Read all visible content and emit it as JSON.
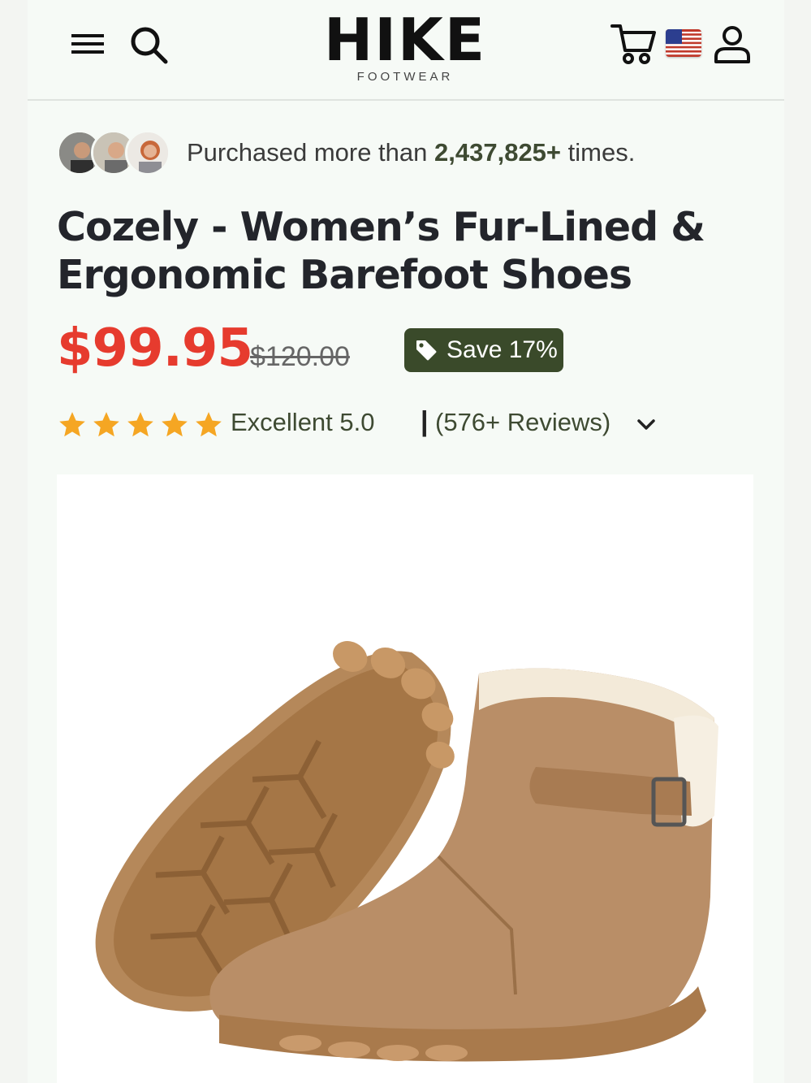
{
  "header": {
    "logo_main": "HIKE",
    "logo_sub": "FOOTWEAR",
    "icons": [
      "menu-icon",
      "search-icon",
      "cart-icon",
      "us-flag-icon",
      "user-icon"
    ]
  },
  "social_proof": {
    "prefix": "Purchased more than ",
    "count": "2,437,825+",
    "suffix": " times."
  },
  "product": {
    "title": "Cozely - Women’s Fur-Lined & Ergonomic Barefoot Shoes",
    "price": "$99.95",
    "compare_price": "$120.00",
    "save_label": "Save 17%",
    "rating": {
      "stars": 5,
      "text": "Excellent 5.0",
      "separator": "|",
      "reviews": "(576+ Reviews)"
    }
  },
  "colors": {
    "price_red": "#e63b2e",
    "badge_green": "#3a4a2a",
    "star_orange": "#f5a623",
    "page_bg": "#f6faf6"
  }
}
